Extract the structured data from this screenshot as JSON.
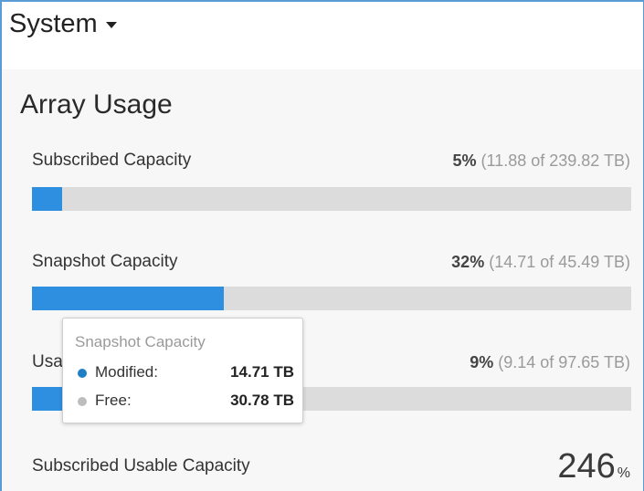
{
  "header": {
    "title": "System"
  },
  "panel": {
    "title": "Array Usage",
    "rows": [
      {
        "label": "Subscribed Capacity",
        "percent": "5%",
        "detail": "(11.88 of 239.82 TB)",
        "fill_fraction": 0.05
      },
      {
        "label": "Snapshot Capacity",
        "percent": "32%",
        "detail": "(14.71 of 45.49 TB)",
        "fill_fraction": 0.32
      },
      {
        "label": "Usable Capacity",
        "visible_label": "Usa",
        "percent": "9%",
        "detail": "(9.14 of 97.65 TB)",
        "fill_fraction": 0.09
      }
    ],
    "subscribed_usable": {
      "label": "Subscribed Usable Capacity",
      "value": "246",
      "unit": "%"
    }
  },
  "tooltip": {
    "title": "Snapshot Capacity",
    "items": [
      {
        "label": "Modified:",
        "value": "14.71 TB",
        "color": "#1f7fc4"
      },
      {
        "label": "Free:",
        "value": "30.78 TB",
        "color": "#bdbdbd"
      }
    ]
  },
  "colors": {
    "accent": "#2e8fe0",
    "bar_track": "#dcdcdc",
    "frame": "#5b9bd5"
  }
}
